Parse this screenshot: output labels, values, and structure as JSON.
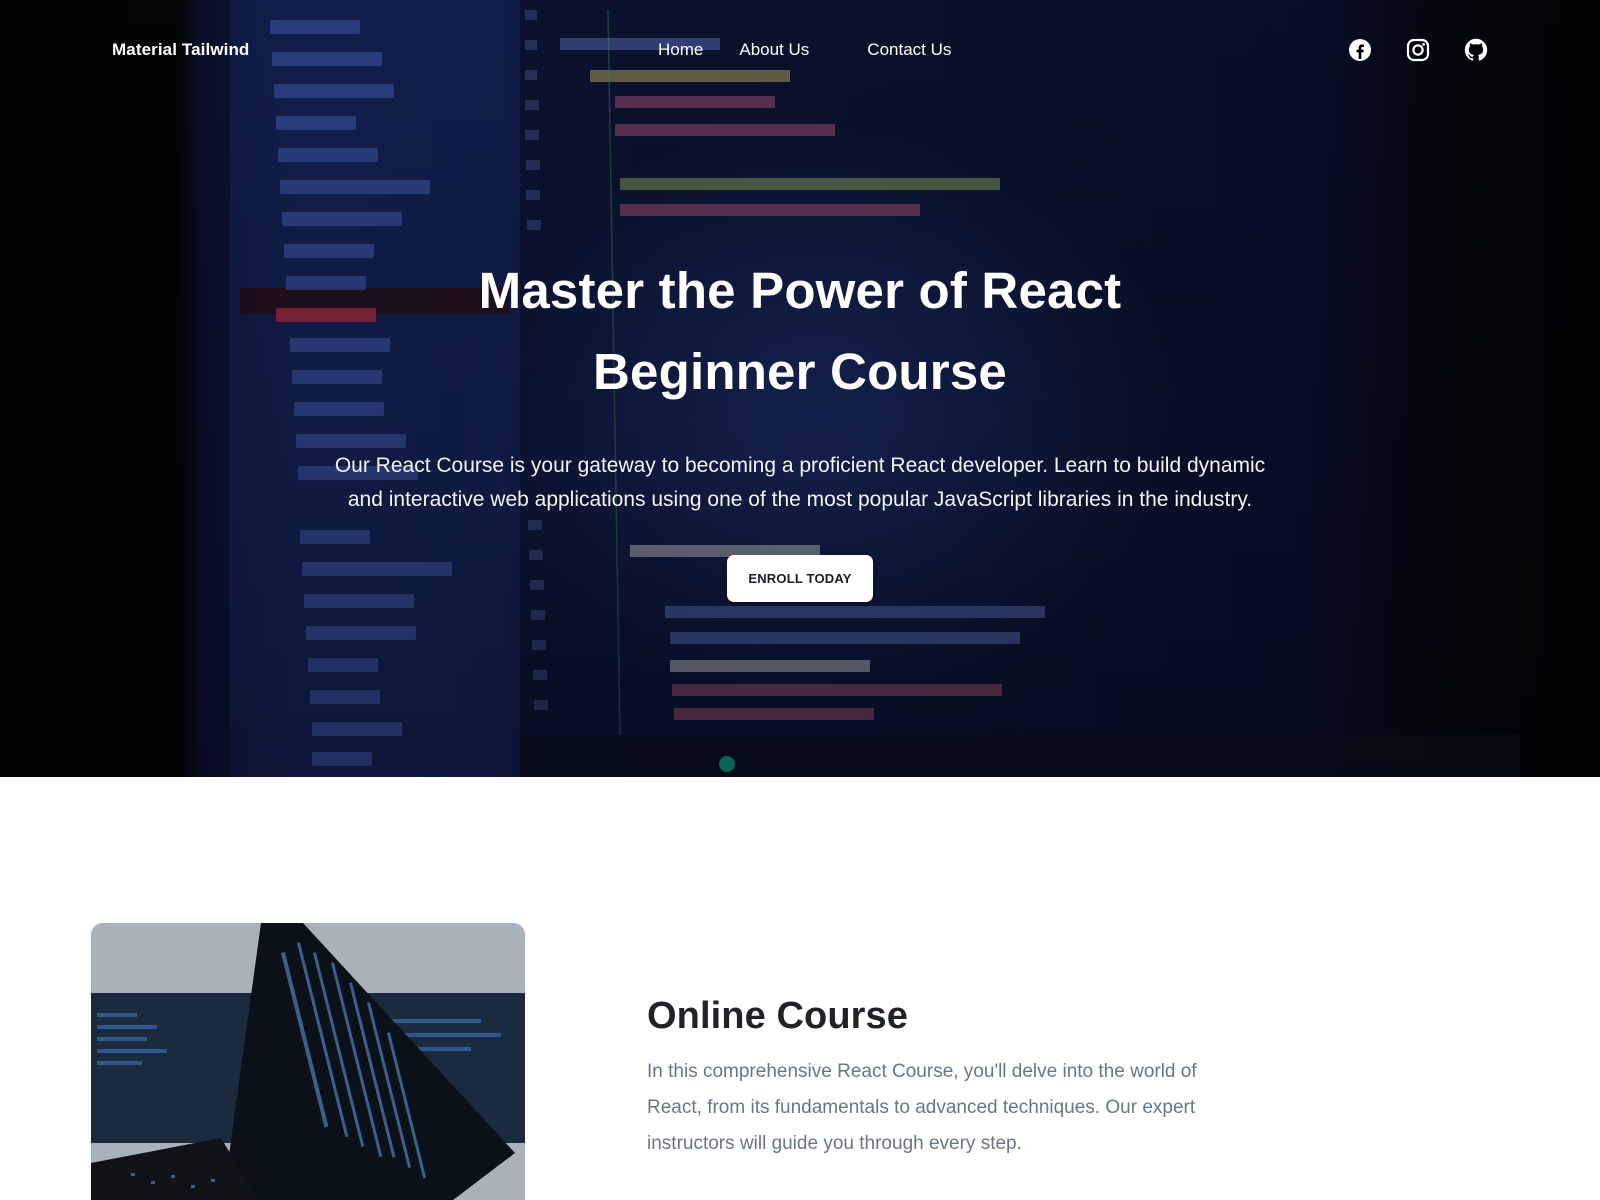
{
  "navbar": {
    "brand": "Material Tailwind",
    "links": [
      {
        "label": "Home"
      },
      {
        "label": "About Us"
      },
      {
        "label": "Contact Us"
      }
    ],
    "icons": [
      "facebook-icon",
      "instagram-icon",
      "github-icon"
    ]
  },
  "hero": {
    "title_line1": "Master the Power of React",
    "title_line2": "Beginner Course",
    "description": "Our React Course is your gateway to becoming a proficient React developer. Learn to build dynamic and interactive web applications using one of the most popular JavaScript libraries in the industry.",
    "cta_label": "ENROLL TODAY"
  },
  "course": {
    "title": "Online Course",
    "description": "In this comprehensive React Course, you'll delve into the world of React, from its fundamentals to advanced techniques. Our expert instructors will guide you through every step."
  },
  "colors": {
    "hero_overlay": "#0b1433",
    "button_bg": "#ffffff",
    "course_title": "#1f2328",
    "course_desc": "#6b7684"
  }
}
